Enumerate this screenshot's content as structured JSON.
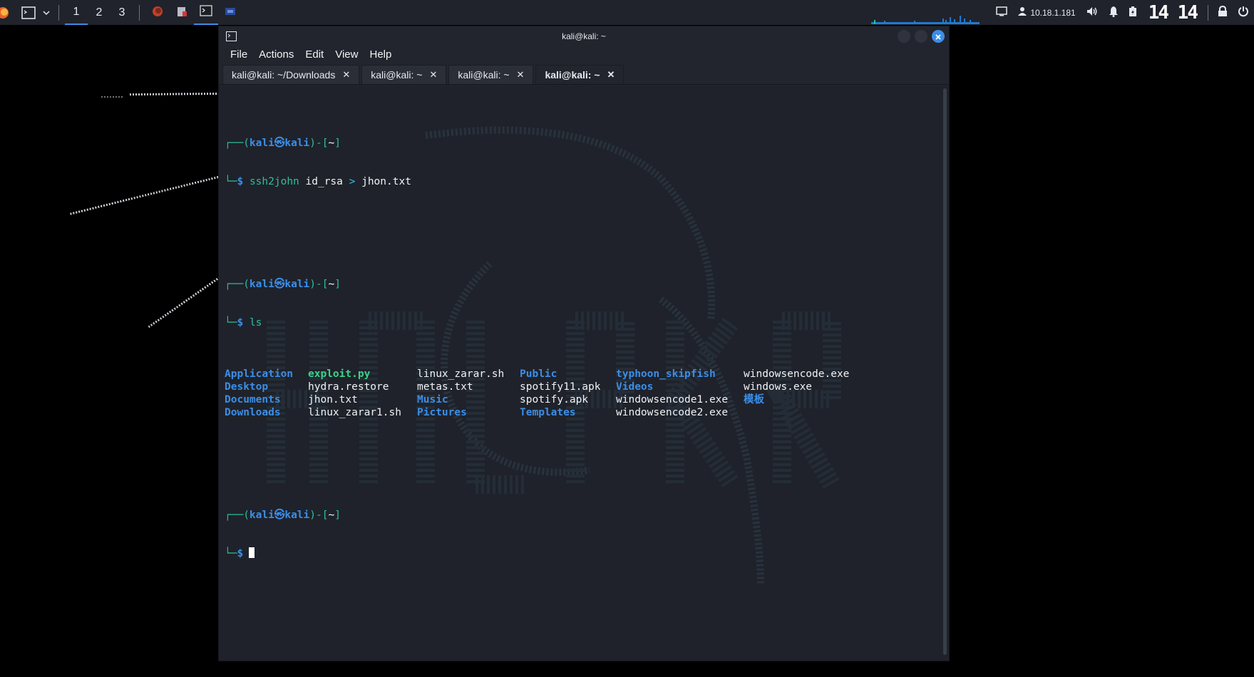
{
  "colors": {
    "accent": "#3b8ee8",
    "prompt_green": "#2fbf9b",
    "directory_blue": "#3b8ee8",
    "executable_green": "#3ad38a",
    "terminal_bg": "#1f222a",
    "panel_bg": "#20232b"
  },
  "panel": {
    "workspaces": [
      "1",
      "2",
      "3"
    ],
    "active_workspace": "1",
    "taskbar_icons": [
      "firefox-icon",
      "file-manager-icon",
      "terminal-icon",
      "screen-icon"
    ],
    "ip": "10.18.1.181",
    "clock": "14 14"
  },
  "window": {
    "title": "kali@kali: ~",
    "menu": [
      "File",
      "Actions",
      "Edit",
      "View",
      "Help"
    ],
    "tabs": [
      {
        "label": "kali@kali: ~/Downloads",
        "close": "✕"
      },
      {
        "label": "kali@kali: ~",
        "close": "✕"
      },
      {
        "label": "kali@kali: ~",
        "close": "✕"
      },
      {
        "label": "kali@kali: ~",
        "close": "✕",
        "active": true
      }
    ]
  },
  "terminal": {
    "prompt": {
      "corner_top": "┌──(",
      "user": "kali",
      "at": "㉿",
      "host": "kali",
      "dir_open": ")-[",
      "dir": "~",
      "dir_close": "]",
      "corner_bottom": "└─",
      "dollar": "$"
    },
    "cmd1": {
      "name": "ssh2john",
      "args": " id_rsa ",
      "redirect": ">",
      "target": " jhon.txt"
    },
    "cmd2": {
      "name": "ls"
    },
    "ls_rows": [
      [
        {
          "t": "Application",
          "k": "dir"
        },
        {
          "t": "exploit.py",
          "k": "exec"
        },
        {
          "t": "linux_zarar.sh",
          "k": "file"
        },
        {
          "t": "Public",
          "k": "dir"
        },
        {
          "t": "typhoon_skipfish",
          "k": "dir"
        },
        {
          "t": "windowsencode.exe",
          "k": "file"
        }
      ],
      [
        {
          "t": "Desktop",
          "k": "dir"
        },
        {
          "t": "hydra.restore",
          "k": "file"
        },
        {
          "t": "metas.txt",
          "k": "file"
        },
        {
          "t": "spotify11.apk",
          "k": "file"
        },
        {
          "t": "Videos",
          "k": "dir"
        },
        {
          "t": "windows.exe",
          "k": "file"
        }
      ],
      [
        {
          "t": "Documents",
          "k": "dir"
        },
        {
          "t": "jhon.txt",
          "k": "file"
        },
        {
          "t": "Music",
          "k": "dir"
        },
        {
          "t": "spotify.apk",
          "k": "file"
        },
        {
          "t": "windowsencode1.exe",
          "k": "file"
        },
        {
          "t": "模板",
          "k": "dir"
        }
      ],
      [
        {
          "t": "Downloads",
          "k": "dir"
        },
        {
          "t": "linux_zarar1.sh",
          "k": "file"
        },
        {
          "t": "Pictures",
          "k": "dir"
        },
        {
          "t": "Templates",
          "k": "dir"
        },
        {
          "t": "windowsencode2.exe",
          "k": "file"
        },
        {
          "t": "",
          "k": "file"
        }
      ]
    ]
  }
}
